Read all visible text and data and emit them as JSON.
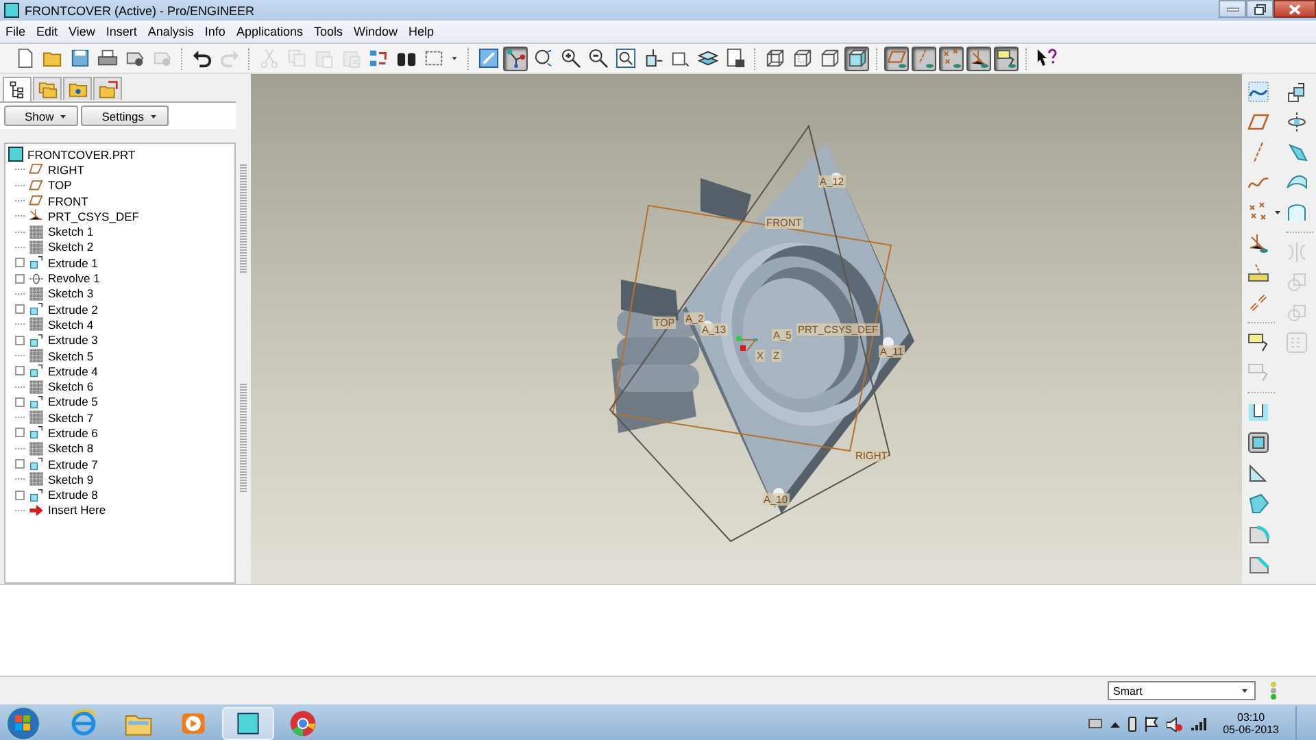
{
  "window": {
    "title": "FRONTCOVER (Active) - Pro/ENGINEER"
  },
  "menu": [
    "File",
    "Edit",
    "View",
    "Insert",
    "Analysis",
    "Info",
    "Applications",
    "Tools",
    "Window",
    "Help"
  ],
  "toolbar": [
    {
      "kind": "new",
      "pressed": false,
      "disabled": false
    },
    {
      "kind": "open",
      "pressed": false,
      "disabled": false
    },
    {
      "kind": "save",
      "pressed": false,
      "disabled": false
    },
    {
      "kind": "print",
      "pressed": false,
      "disabled": false
    },
    {
      "kind": "tag",
      "pressed": false,
      "disabled": false
    },
    {
      "kind": "tag",
      "pressed": false,
      "disabled": true
    },
    {
      "kind": "sep"
    },
    {
      "kind": "undo",
      "pressed": false,
      "disabled": false
    },
    {
      "kind": "redo",
      "pressed": false,
      "disabled": true
    },
    {
      "kind": "sep"
    },
    {
      "kind": "cut",
      "pressed": false,
      "disabled": true
    },
    {
      "kind": "copy",
      "pressed": false,
      "disabled": true
    },
    {
      "kind": "paste",
      "pressed": false,
      "disabled": true
    },
    {
      "kind": "pastespecial",
      "pressed": false,
      "disabled": true
    },
    {
      "kind": "regenerate",
      "pressed": false,
      "disabled": false
    },
    {
      "kind": "find",
      "pressed": false,
      "disabled": false
    },
    {
      "kind": "select",
      "pressed": false,
      "disabled": false
    },
    {
      "kind": "dropdown",
      "pressed": false,
      "disabled": false
    },
    {
      "kind": "sep"
    },
    {
      "kind": "repaint",
      "pressed": false,
      "disabled": false
    },
    {
      "kind": "spincenter",
      "pressed": true,
      "disabled": false
    },
    {
      "kind": "orient",
      "pressed": false,
      "disabled": false
    },
    {
      "kind": "zoomin",
      "pressed": false,
      "disabled": false
    },
    {
      "kind": "zoomout",
      "pressed": false,
      "disabled": false
    },
    {
      "kind": "refit",
      "pressed": false,
      "disabled": false
    },
    {
      "kind": "reorient",
      "pressed": false,
      "disabled": false
    },
    {
      "kind": "views",
      "pressed": false,
      "disabled": false
    },
    {
      "kind": "layers",
      "pressed": false,
      "disabled": false
    },
    {
      "kind": "setup",
      "pressed": false,
      "disabled": false
    },
    {
      "kind": "sep"
    },
    {
      "kind": "wireframe",
      "pressed": false,
      "disabled": false
    },
    {
      "kind": "hidden",
      "pressed": false,
      "disabled": false
    },
    {
      "kind": "nohidden",
      "pressed": false,
      "disabled": false
    },
    {
      "kind": "shading",
      "pressed": true,
      "disabled": false
    },
    {
      "kind": "sep"
    },
    {
      "kind": "planes",
      "pressed": true,
      "disabled": false
    },
    {
      "kind": "axes",
      "pressed": true,
      "disabled": false
    },
    {
      "kind": "points",
      "pressed": true,
      "disabled": false
    },
    {
      "kind": "csys",
      "pressed": true,
      "disabled": false
    },
    {
      "kind": "notes",
      "pressed": true,
      "disabled": false
    },
    {
      "kind": "sep"
    },
    {
      "kind": "help",
      "pressed": false,
      "disabled": false
    }
  ],
  "navigator": {
    "tabs": [
      {
        "kind": "tree",
        "selected": true
      },
      {
        "kind": "folders",
        "selected": false
      },
      {
        "kind": "favorites",
        "selected": false
      },
      {
        "kind": "connections",
        "selected": false
      }
    ],
    "buttons": [
      "Show",
      "Settings"
    ],
    "tree": {
      "label": "FRONTCOVER.PRT",
      "children": [
        {
          "label": "RIGHT",
          "kind": "plane",
          "expandable": false
        },
        {
          "label": "TOP",
          "kind": "plane",
          "expandable": false
        },
        {
          "label": "FRONT",
          "kind": "plane",
          "expandable": false
        },
        {
          "label": "PRT_CSYS_DEF",
          "kind": "csys",
          "expandable": false
        },
        {
          "label": "Sketch 1",
          "kind": "sketch",
          "expandable": false
        },
        {
          "label": "Sketch 2",
          "kind": "sketch",
          "expandable": false
        },
        {
          "label": "Extrude 1",
          "kind": "extrude",
          "expandable": true
        },
        {
          "label": "Revolve 1",
          "kind": "revolve",
          "expandable": true
        },
        {
          "label": "Sketch 3",
          "kind": "sketch",
          "expandable": false
        },
        {
          "label": "Extrude 2",
          "kind": "extrude",
          "expandable": true
        },
        {
          "label": "Sketch 4",
          "kind": "sketch",
          "expandable": false
        },
        {
          "label": "Extrude 3",
          "kind": "extrude",
          "expandable": true
        },
        {
          "label": "Sketch 5",
          "kind": "sketch",
          "expandable": false
        },
        {
          "label": "Extrude 4",
          "kind": "extrude",
          "expandable": true
        },
        {
          "label": "Sketch 6",
          "kind": "sketch",
          "expandable": false
        },
        {
          "label": "Extrude 5",
          "kind": "extrude",
          "expandable": true
        },
        {
          "label": "Sketch 7",
          "kind": "sketch",
          "expandable": false
        },
        {
          "label": "Extrude 6",
          "kind": "extrude",
          "expandable": true
        },
        {
          "label": "Sketch 8",
          "kind": "sketch",
          "expandable": false
        },
        {
          "label": "Extrude 7",
          "kind": "extrude",
          "expandable": true
        },
        {
          "label": "Sketch 9",
          "kind": "sketch",
          "expandable": false
        },
        {
          "label": "Extrude 8",
          "kind": "extrude",
          "expandable": true
        },
        {
          "label": "Insert Here",
          "kind": "insert",
          "expandable": false
        }
      ]
    }
  },
  "graphics": {
    "labels": [
      "A_12",
      "FRONT",
      "TOP",
      "A_2",
      "A_13",
      "A_5",
      "PRT_CSYS_DEF",
      "X",
      "Z",
      "A_11",
      "RIGHT",
      "A_10"
    ]
  },
  "feature_toolbar": {
    "column_1": [
      {
        "kind": "sketch",
        "disabled": false
      },
      {
        "kind": "plane",
        "disabled": false
      },
      {
        "kind": "axis",
        "disabled": false
      },
      {
        "kind": "curve",
        "disabled": false
      },
      {
        "kind": "pointmenu",
        "disabled": false
      },
      {
        "kind": "csys",
        "disabled": false
      },
      {
        "kind": "analysis",
        "disabled": false
      },
      {
        "kind": "chain",
        "disabled": false
      },
      {
        "kind": "sep"
      },
      {
        "kind": "note",
        "disabled": false
      },
      {
        "kind": "note",
        "disabled": true
      },
      {
        "kind": "sep"
      },
      {
        "kind": "hole",
        "disabled": false
      },
      {
        "kind": "shell",
        "disabled": false
      },
      {
        "kind": "rib",
        "disabled": false
      },
      {
        "kind": "draft",
        "disabled": false
      },
      {
        "kind": "round",
        "disabled": false
      },
      {
        "kind": "chamfer",
        "disabled": false
      }
    ],
    "column_2": [
      {
        "kind": "extrude",
        "disabled": false
      },
      {
        "kind": "revolve",
        "disabled": false
      },
      {
        "kind": "sweep",
        "disabled": false
      },
      {
        "kind": "blend",
        "disabled": false
      },
      {
        "kind": "boundary",
        "disabled": false
      },
      {
        "kind": "sep"
      },
      {
        "kind": "mirror",
        "disabled": true
      },
      {
        "kind": "merge",
        "disabled": true
      },
      {
        "kind": "intersect",
        "disabled": true
      },
      {
        "kind": "pattern",
        "disabled": true
      }
    ]
  },
  "status_bar": {
    "filter": "Smart"
  },
  "taskbar": {
    "apps": [
      {
        "kind": "browser",
        "selected": false
      },
      {
        "kind": "explorer",
        "selected": false
      },
      {
        "kind": "media",
        "selected": false
      },
      {
        "kind": "proe",
        "selected": true
      },
      {
        "kind": "chrome",
        "selected": false
      }
    ],
    "time": "03:10",
    "date": "05-06-2013"
  }
}
